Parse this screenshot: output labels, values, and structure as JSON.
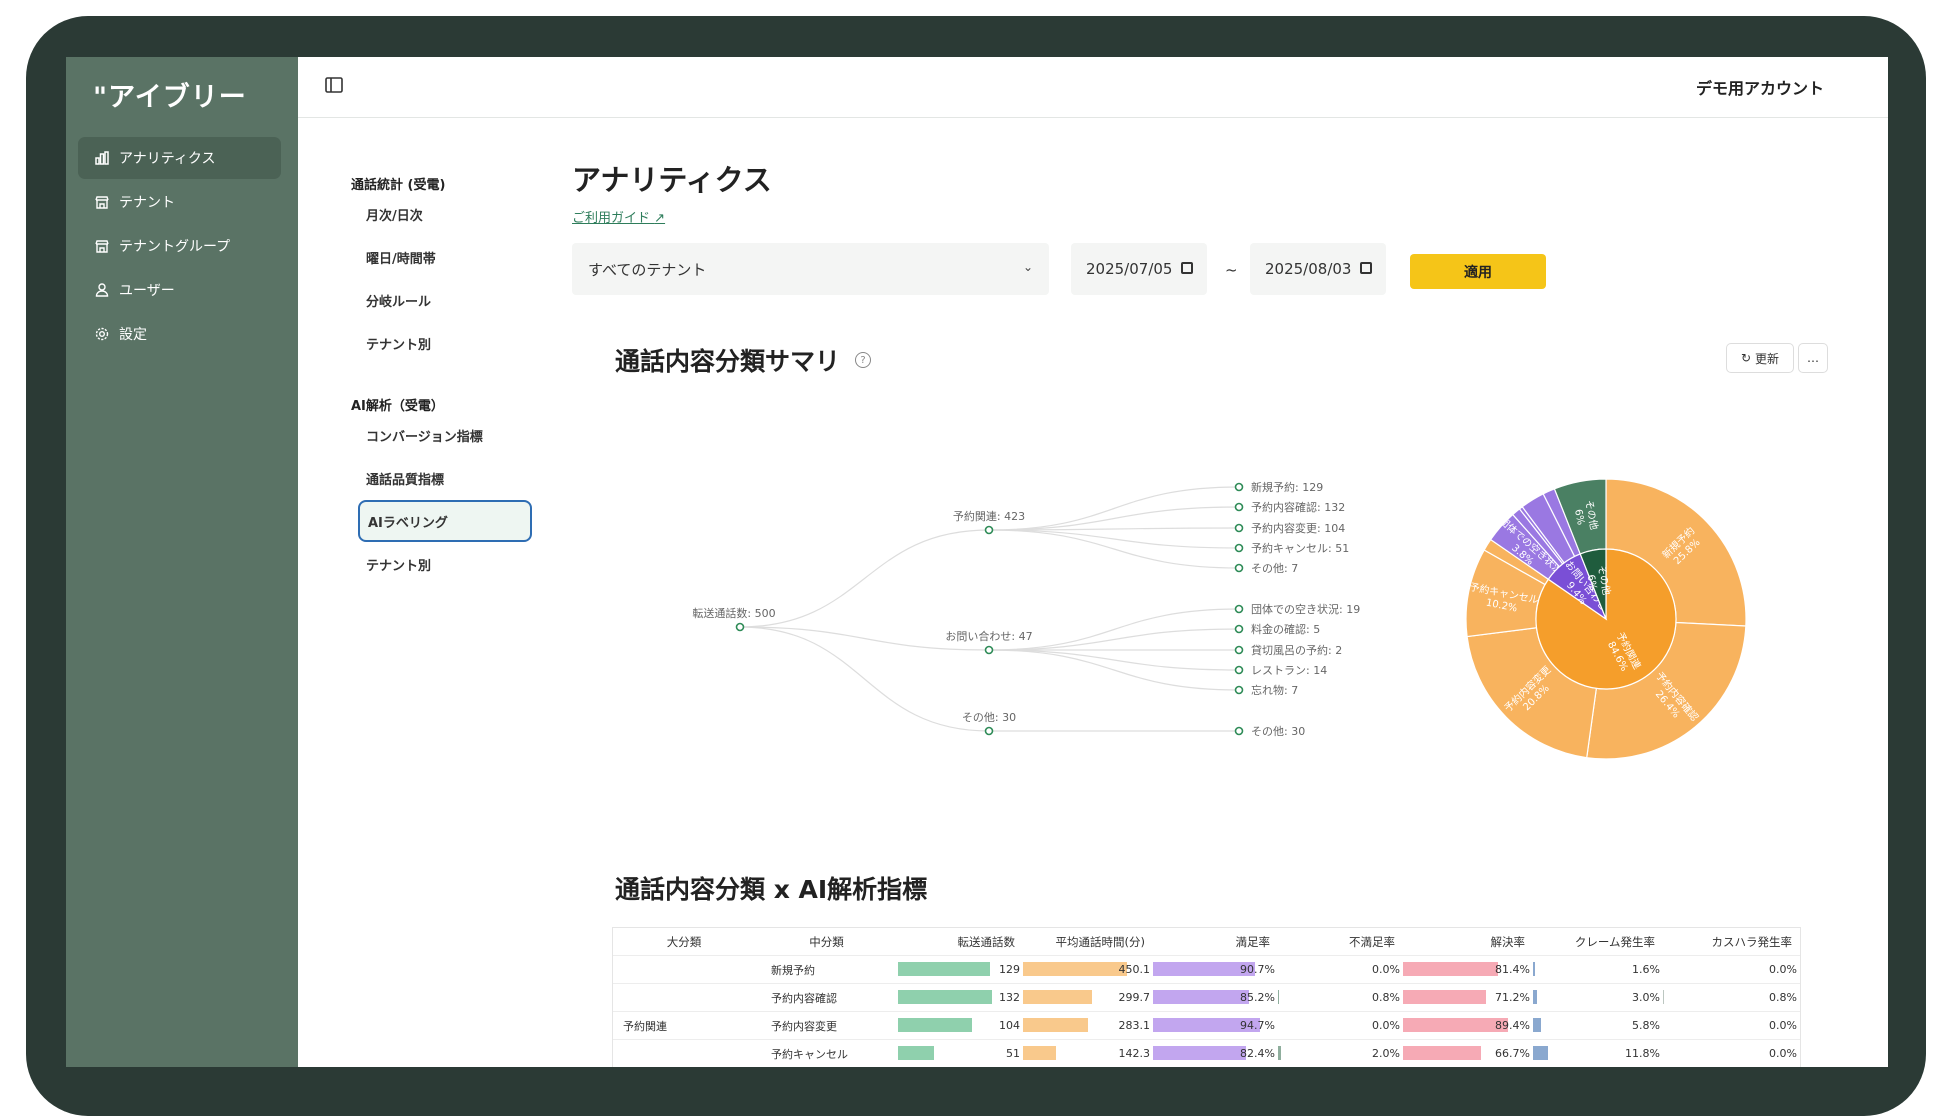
{
  "app": {
    "logo": "\"アイブリー",
    "account": "デモ用アカウント"
  },
  "sidebar": {
    "items": [
      {
        "label": "アナリティクス",
        "icon": "bar-chart-icon",
        "active": true
      },
      {
        "label": "テナント",
        "icon": "store-icon"
      },
      {
        "label": "テナントグループ",
        "icon": "store-icon"
      },
      {
        "label": "ユーザー",
        "icon": "user-icon"
      },
      {
        "label": "設定",
        "icon": "gear-icon"
      }
    ]
  },
  "subnav": {
    "group1": "通話統計 (受電)",
    "group1_items": [
      "月次/日次",
      "曜日/時間帯",
      "分岐ルール",
      "テナント別"
    ],
    "group2": "AI解析（受電）",
    "group2_items": [
      "コンバージョン指標",
      "通話品質指標",
      "AIラベリング",
      "テナント別"
    ],
    "active": "AIラベリング"
  },
  "page": {
    "title": "アナリティクス",
    "guide_link": "ご利用ガイド",
    "tenant_select": "すべてのテナント",
    "date_from": "2025/07/05",
    "date_sep": "~",
    "date_to": "2025/08/03",
    "apply": "適用"
  },
  "summary": {
    "title": "通話内容分類サマリ",
    "refresh": "更新",
    "more": "…",
    "tree": {
      "root": "転送通話数: 500",
      "groups": [
        {
          "label": "予約関連: 423",
          "children": [
            "新規予約: 129",
            "予約内容確認: 132",
            "予約内容変更: 104",
            "予約キャンセル: 51",
            "その他: 7"
          ]
        },
        {
          "label": "お問い合わせ: 47",
          "children": [
            "団体での空き状況: 19",
            "料金の確認: 5",
            "貸切風呂の予約: 2",
            "レストラン: 14",
            "忘れ物: 7"
          ]
        },
        {
          "label": "その他: 30",
          "children": [
            "その他: 30"
          ]
        }
      ]
    }
  },
  "chart_data": {
    "type": "sunburst",
    "inner": [
      {
        "name": "予約関連",
        "value": 423,
        "label": "予約関連\n84.6%",
        "color": "#f59e2b"
      },
      {
        "name": "お問い合わせ",
        "value": 47,
        "label": "お問い合わせ\n9.4%",
        "color": "#7a4fd6"
      },
      {
        "name": "その他",
        "value": 30,
        "label": "その他\n6%",
        "color": "#1f5c3d"
      }
    ],
    "outer": [
      {
        "name": "新規予約",
        "value": 129,
        "label": "新規予約\n25.8%",
        "color": "#f8b35e"
      },
      {
        "name": "予約内容確認",
        "value": 132,
        "label": "予約内容確認\n26.4%",
        "color": "#f8b35e"
      },
      {
        "name": "予約内容変更",
        "value": 104,
        "label": "予約内容変更\n20.8%",
        "color": "#f8b35e"
      },
      {
        "name": "予約キャンセル",
        "value": 51,
        "label": "予約キャンセル\n10.2%",
        "color": "#f8b35e"
      },
      {
        "name": "その他",
        "value": 7,
        "label": "",
        "color": "#f8b35e"
      },
      {
        "name": "団体での空き状況",
        "value": 19,
        "label": "団体での空き状況\n3.8%",
        "color": "#9a78e2"
      },
      {
        "name": "料金の確認",
        "value": 5,
        "label": "",
        "color": "#9a78e2"
      },
      {
        "name": "貸切風呂の予約",
        "value": 2,
        "label": "",
        "color": "#9a78e2"
      },
      {
        "name": "レストラン",
        "value": 14,
        "label": "",
        "color": "#9a78e2"
      },
      {
        "name": "忘れ物",
        "value": 7,
        "label": "",
        "color": "#9a78e2"
      },
      {
        "name": "その他",
        "value": 30,
        "label": "その他\n6%",
        "color": "#4a8063"
      }
    ]
  },
  "table": {
    "title": "通話内容分類 x AI解析指標",
    "headers": [
      "大分類",
      "中分類",
      "転送通話数",
      "平均通話時間(分)",
      "満足率",
      "不満足率",
      "解決率",
      "クレーム発生率",
      "カスハラ発生率"
    ],
    "group_label": "予約関連",
    "rows": [
      {
        "sub": "新規予約",
        "calls": "129",
        "calls_v": 129,
        "avg": "450.1",
        "avg_v": 450.1,
        "sat": "90.7%",
        "sat_v": 90.7,
        "dis": "0.0%",
        "dis_v": 0,
        "res": "81.4%",
        "res_v": 81.4,
        "claim": "1.6%",
        "claim_v": 1.6,
        "harass": "0.0%",
        "harass_v": 0
      },
      {
        "sub": "予約内容確認",
        "calls": "132",
        "calls_v": 132,
        "avg": "299.7",
        "avg_v": 299.7,
        "sat": "85.2%",
        "sat_v": 85.2,
        "dis": "0.8%",
        "dis_v": 0.8,
        "res": "71.2%",
        "res_v": 71.2,
        "claim": "3.0%",
        "claim_v": 3.0,
        "harass": "0.8%",
        "harass_v": 0.8
      },
      {
        "sub": "予約内容変更",
        "calls": "104",
        "calls_v": 104,
        "avg": "283.1",
        "avg_v": 283.1,
        "sat": "94.7%",
        "sat_v": 94.7,
        "dis": "0.0%",
        "dis_v": 0,
        "res": "89.4%",
        "res_v": 89.4,
        "claim": "5.8%",
        "claim_v": 5.8,
        "harass": "0.0%",
        "harass_v": 0
      },
      {
        "sub": "予約キャンセル",
        "calls": "51",
        "calls_v": 51,
        "avg": "142.3",
        "avg_v": 142.3,
        "sat": "82.4%",
        "sat_v": 82.4,
        "dis": "2.0%",
        "dis_v": 2.0,
        "res": "66.7%",
        "res_v": 66.7,
        "claim": "11.8%",
        "claim_v": 11.8,
        "harass": "0.0%",
        "harass_v": 0
      }
    ]
  },
  "colors": {
    "sidebar": "#5a7365",
    "accent": "#f5c518",
    "calls": "#8fd0ad",
    "avg": "#f9c98c",
    "sat": "#c2a6ef",
    "dis": "#8fae9d",
    "res": "#f6aab5",
    "claim": "#8aa8cf",
    "harass": "#bcc7c1"
  }
}
